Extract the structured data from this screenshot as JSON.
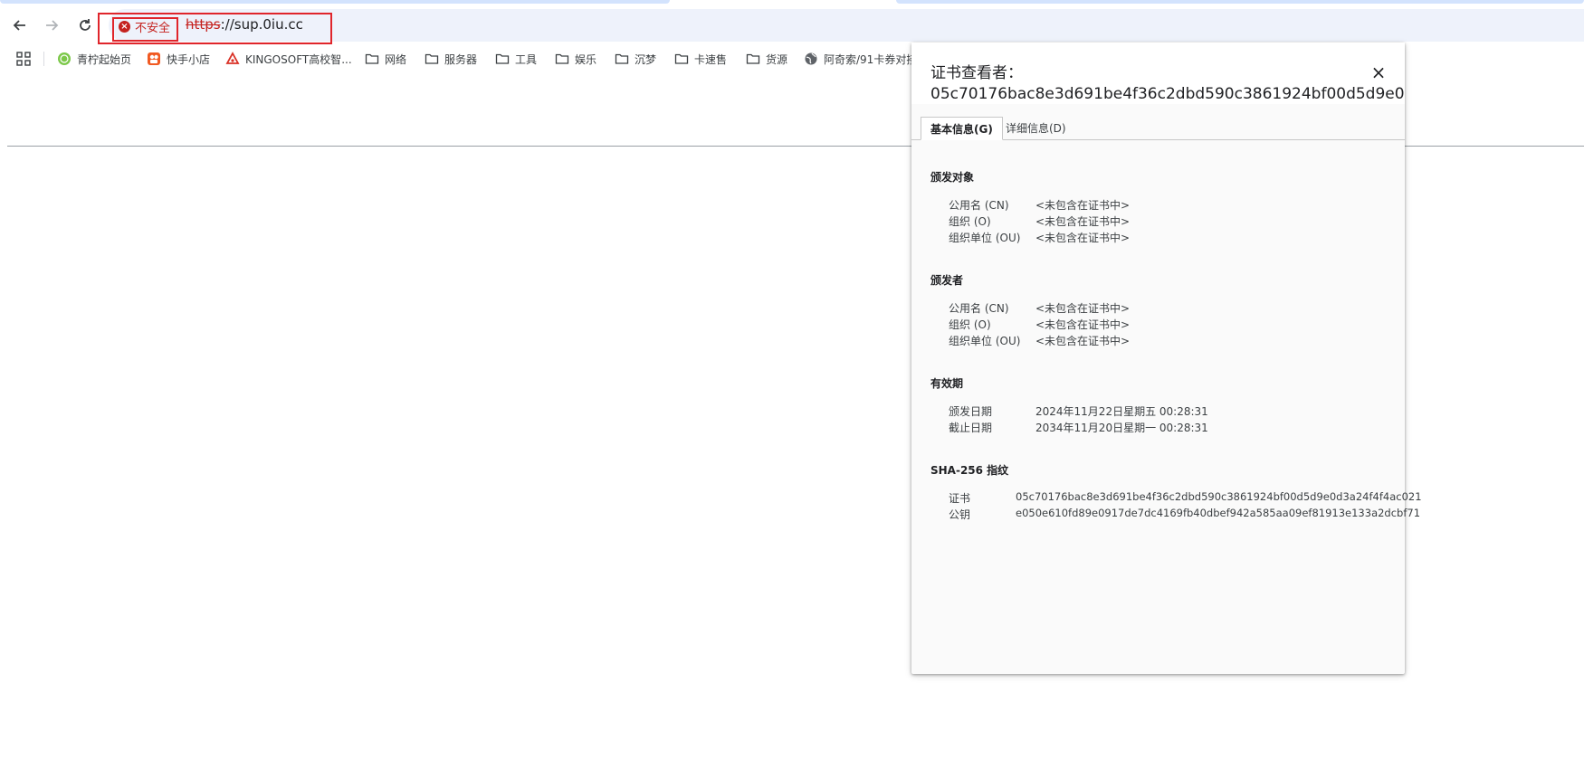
{
  "browser": {
    "security_chip": "不安全",
    "url_scheme": "https",
    "url_rest": "://sup.0iu.cc"
  },
  "bookmarks": [
    {
      "label": "青柠起始页",
      "icon": "lime-icon"
    },
    {
      "label": "快手小店",
      "icon": "kuaishou-icon"
    },
    {
      "label": "KINGOSOFT高校智...",
      "icon": "kingosoft-icon"
    },
    {
      "label": "网络",
      "icon": "folder-icon"
    },
    {
      "label": "服务器",
      "icon": "folder-icon"
    },
    {
      "label": "工具",
      "icon": "folder-icon"
    },
    {
      "label": "娱乐",
      "icon": "folder-icon"
    },
    {
      "label": "沉梦",
      "icon": "folder-icon"
    },
    {
      "label": "卡速售",
      "icon": "folder-icon"
    },
    {
      "label": "货源",
      "icon": "folder-icon"
    },
    {
      "label": "阿奇索/91卡券对接",
      "icon": "globe-icon"
    }
  ],
  "cert_viewer": {
    "title_line1": "证书查看者：",
    "title_line2": "05c70176bac8e3d691be4f36c2dbd590c3861924bf00d5d9e0",
    "close": "×",
    "tabs": [
      "基本信息(G)",
      "详细信息(D)"
    ],
    "issued_to": {
      "title": "颁发对象",
      "rows": [
        {
          "label": "公用名 (CN)",
          "value": "<未包含在证书中>"
        },
        {
          "label": "组织 (O)",
          "value": "<未包含在证书中>"
        },
        {
          "label": "组织单位 (OU)",
          "value": "<未包含在证书中>"
        }
      ]
    },
    "issued_by": {
      "title": "颁发者",
      "rows": [
        {
          "label": "公用名 (CN)",
          "value": "<未包含在证书中>"
        },
        {
          "label": "组织 (O)",
          "value": "<未包含在证书中>"
        },
        {
          "label": "组织单位 (OU)",
          "value": "<未包含在证书中>"
        }
      ]
    },
    "validity": {
      "title": "有效期",
      "rows": [
        {
          "label": "颁发日期",
          "value": "2024年11月22日星期五 00:28:31"
        },
        {
          "label": "截止日期",
          "value": "2034年11月20日星期一 00:28:31"
        }
      ]
    },
    "fingerprints": {
      "title": "SHA-256 指纹",
      "rows": [
        {
          "label": "证书",
          "value": "05c70176bac8e3d691be4f36c2dbd590c3861924bf00d5d9e0d3a24f4f4ac021"
        },
        {
          "label": "公钥",
          "value": "e050e610fd89e0917de7dc4169fb40dbef942a585aa09ef81913e133a2dcbf71"
        }
      ]
    }
  }
}
